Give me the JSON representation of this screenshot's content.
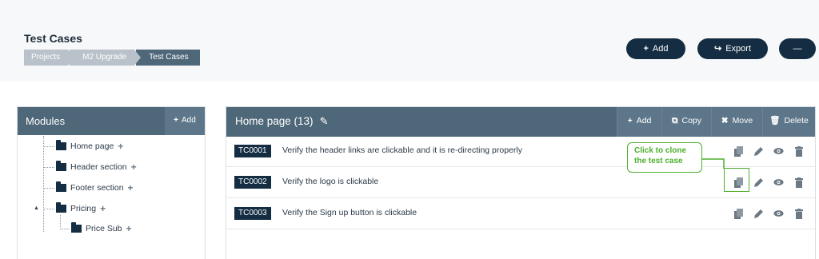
{
  "page": {
    "title": "Test Cases",
    "breadcrumb": [
      "Projects",
      "M2 Upgrade",
      "Test Cases"
    ]
  },
  "top_actions": {
    "add_label": "Add",
    "export_label": "Export",
    "more_label": "—"
  },
  "modules": {
    "title": "Modules",
    "add_label": "Add",
    "items": [
      {
        "label": "Home page"
      },
      {
        "label": "Header section"
      },
      {
        "label": "Footer section"
      },
      {
        "label": "Pricing"
      },
      {
        "label": "Price Sub"
      }
    ]
  },
  "testcases": {
    "title": "Home page (13)",
    "actions": {
      "add": "Add",
      "copy": "Copy",
      "move": "Move",
      "delete": "Delete"
    },
    "rows": [
      {
        "id": "TC0001",
        "text": "Verify the header links are clickable and it is re-directing properly"
      },
      {
        "id": "TC0002",
        "text": "Verify the logo is clickable"
      },
      {
        "id": "TC0003",
        "text": "Verify the Sign up button is clickable"
      }
    ]
  },
  "callout": {
    "line1": "Click to clone",
    "line2": "the test case"
  },
  "icons": [
    "plus-icon",
    "export-icon",
    "pencil-icon",
    "copy-icon",
    "move-icon",
    "trash-icon",
    "eye-icon",
    "folder-icon"
  ],
  "colors": {
    "navy": "#142d43",
    "header_slate": "#4e6779",
    "callout_green": "#4caf2c"
  }
}
